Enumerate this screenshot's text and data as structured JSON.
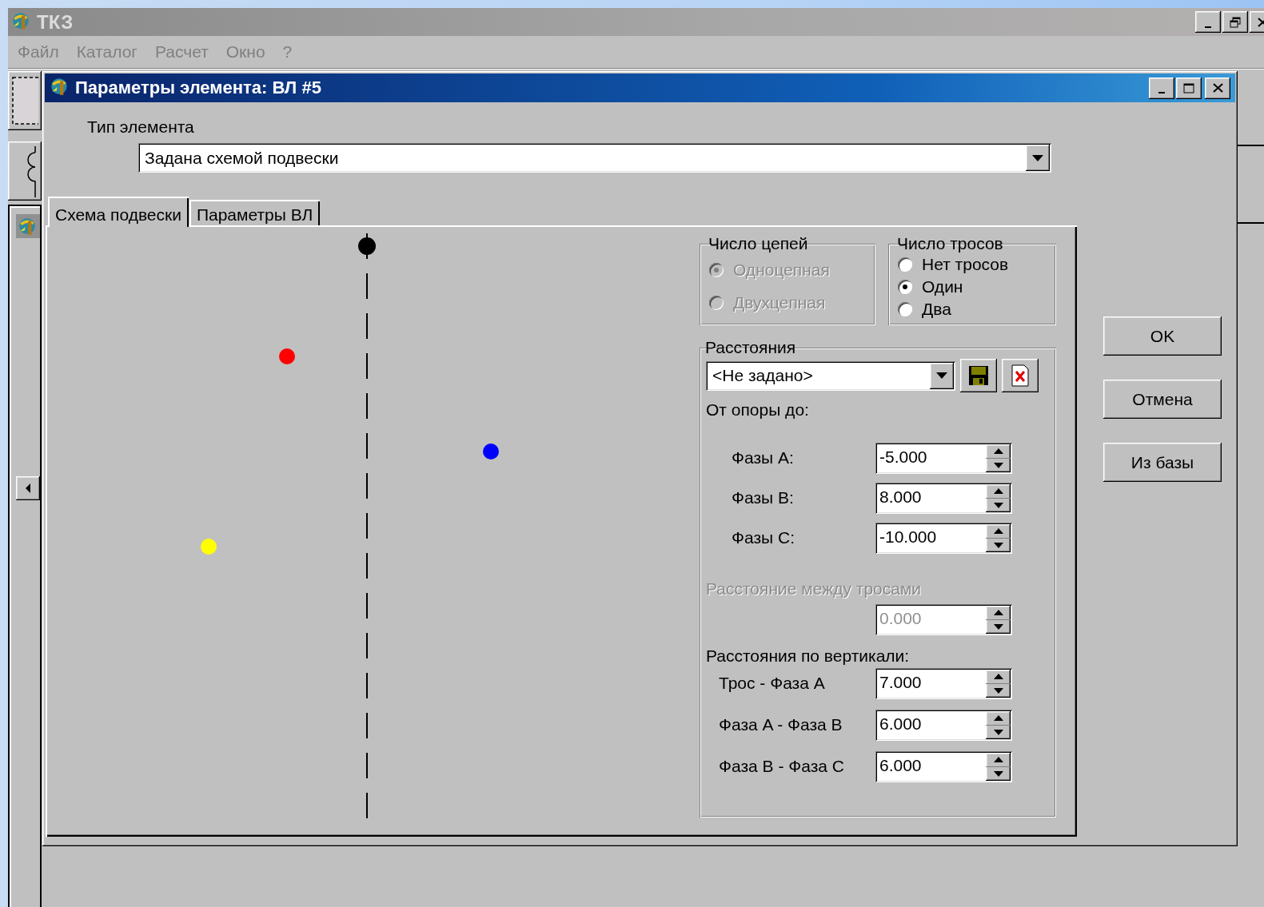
{
  "app": {
    "title": "ТКЗ",
    "menu": [
      "Файл",
      "Каталог",
      "Расчет",
      "Окно",
      "?"
    ]
  },
  "dialog": {
    "title": "Параметры элемента: ВЛ #5",
    "element_type": {
      "label": "Тип элемента",
      "value": "Задана схемой подвески"
    },
    "tabs": [
      {
        "label": "Схема подвески",
        "selected": true
      },
      {
        "label": "Параметры ВЛ",
        "selected": false
      }
    ],
    "scheme": {
      "wires": [
        {
          "color": "#000000"
        },
        {
          "color": "#ff0000"
        },
        {
          "color": "#0000ff"
        },
        {
          "color": "#ffff00"
        }
      ]
    },
    "circuits": {
      "title": "Число цепей",
      "disabled": true,
      "options": [
        {
          "label": "Одноцепная",
          "selected": true
        },
        {
          "label": "Двухцепная",
          "selected": false
        }
      ]
    },
    "cables": {
      "title": "Число тросов",
      "options": [
        {
          "label": "Нет тросов",
          "selected": false
        },
        {
          "label": "Один",
          "selected": true
        },
        {
          "label": "Два",
          "selected": false
        }
      ]
    },
    "distances": {
      "title": "Расстояния",
      "preset": "<Не задано>",
      "from_support_label": "От опоры до:",
      "from_support": [
        {
          "label": "Фазы A:",
          "value": "-5.000"
        },
        {
          "label": "Фазы B:",
          "value": "8.000"
        },
        {
          "label": "Фазы C:",
          "value": "-10.000"
        }
      ],
      "cable_spacing": {
        "label": "Расстояние между тросами",
        "value": "0.000",
        "disabled": true
      },
      "vertical_label": "Расстояния по вертикали:",
      "vertical": [
        {
          "label": "Трос - Фаза A",
          "value": "7.000"
        },
        {
          "label": "Фаза A - Фаза B",
          "value": "6.000"
        },
        {
          "label": "Фаза B - Фаза C",
          "value": "6.000"
        }
      ]
    },
    "buttons": [
      "OK",
      "Отмена",
      "Из базы"
    ]
  }
}
